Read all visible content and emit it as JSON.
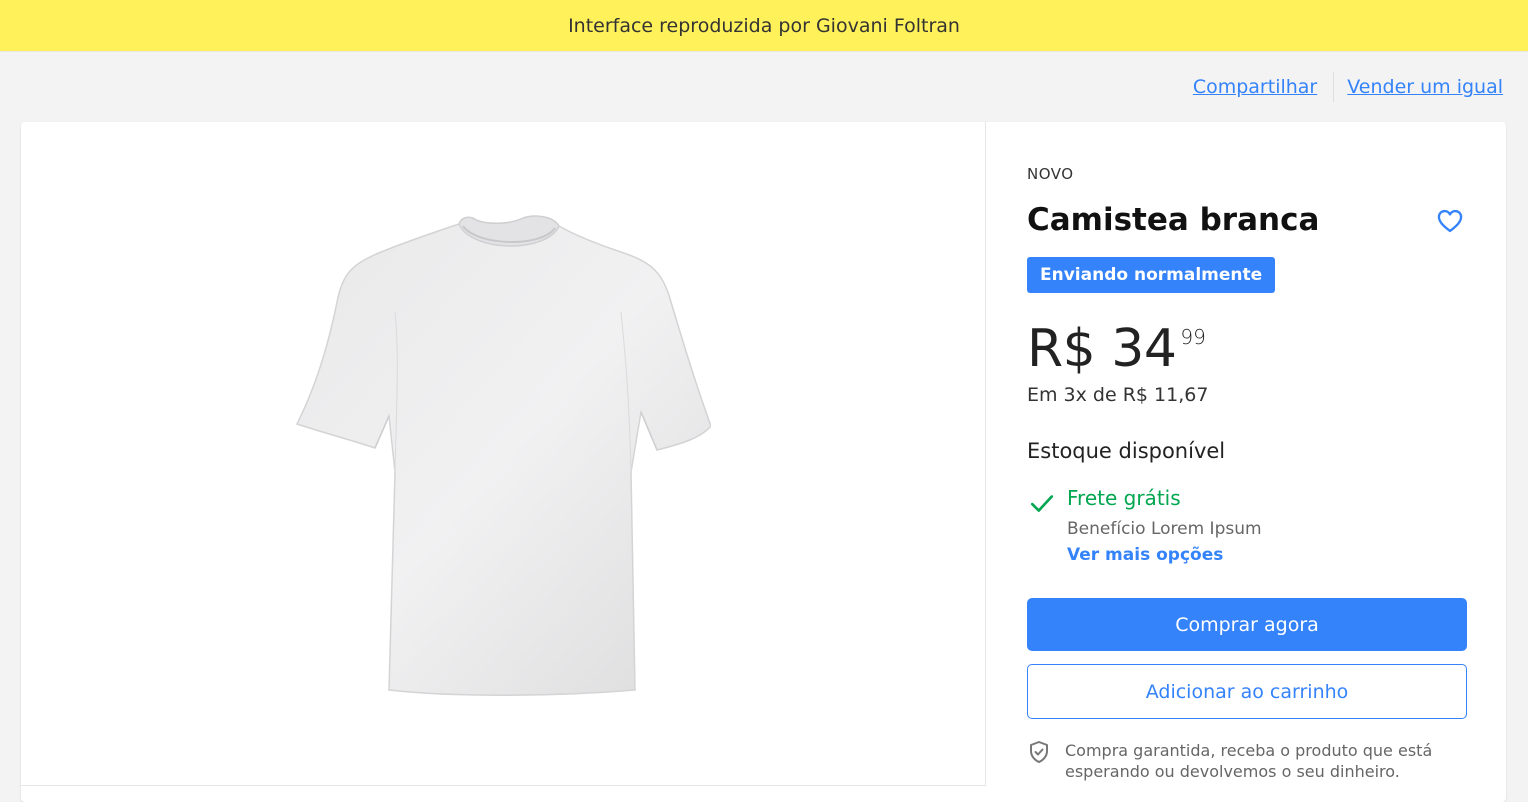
{
  "banner": {
    "text": "Interface reproduzida por Giovani Foltran"
  },
  "links": {
    "share": "Compartilhar",
    "sell": "Vender um igual"
  },
  "product": {
    "condition": "NOVO",
    "title": "Camistea branca",
    "badge": "Enviando normalmente",
    "price_int": "R$ 34",
    "price_cents": "99",
    "installments": "Em 3x de R$ 11,67",
    "stock": "Estoque disponível",
    "shipping": "Frete grátis",
    "benefit": "Benefício Lorem Ipsum",
    "more_options": "Ver mais opções",
    "buy_label": "Comprar agora",
    "cart_label": "Adicionar ao carrinho",
    "guarantee": "Compra garantida, receba o produto que está esperando ou devolvemos o seu dinheiro."
  },
  "colors": {
    "banner": "#fff159",
    "accent": "#3483fa",
    "success": "#00a650"
  },
  "icons": {
    "favorite": "heart-icon",
    "shipping": "check-icon",
    "guarantee": "shield-check-icon"
  }
}
